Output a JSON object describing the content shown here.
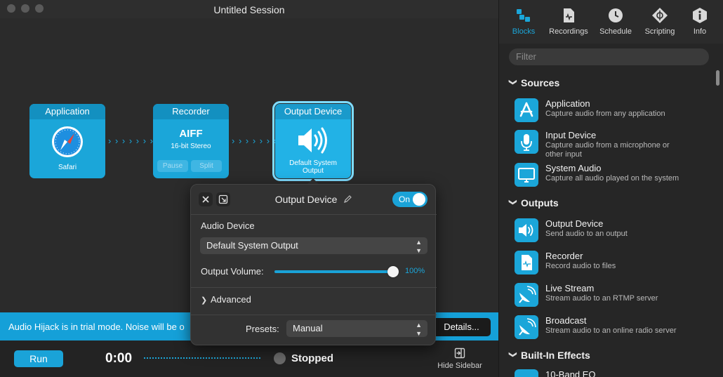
{
  "window": {
    "title": "Untitled Session"
  },
  "blocks": {
    "application": {
      "header": "Application",
      "label": "Safari"
    },
    "recorder": {
      "header": "Recorder",
      "format": "AIFF",
      "detail": "16-bit Stereo",
      "pause_label": "Pause",
      "split_label": "Split"
    },
    "output": {
      "header": "Output Device",
      "label_line1": "Default System",
      "label_line2": "Output"
    }
  },
  "arrows": "› › › › › › ›",
  "popover": {
    "title": "Output Device",
    "toggle_label": "On",
    "audio_device_label": "Audio Device",
    "audio_device_value": "Default System Output",
    "output_volume_label": "Output Volume:",
    "output_volume_percent": 100,
    "output_volume_text": "100%",
    "advanced_label": "Advanced",
    "presets_label": "Presets:",
    "presets_value": "Manual"
  },
  "trial": {
    "text": "Audio Hijack is in trial mode. Noise will be o",
    "details_label": "Details..."
  },
  "transport": {
    "run_label": "Run",
    "time": "0:00",
    "status": "Stopped",
    "hide_sidebar_label": "Hide Sidebar"
  },
  "sidebar": {
    "tabs": [
      {
        "label": "Blocks",
        "icon": "blocks-icon",
        "active": true
      },
      {
        "label": "Recordings",
        "icon": "recordings-icon",
        "active": false
      },
      {
        "label": "Schedule",
        "icon": "clock-icon",
        "active": false
      },
      {
        "label": "Scripting",
        "icon": "scripting-icon",
        "active": false
      },
      {
        "label": "Info",
        "icon": "info-icon",
        "active": false
      }
    ],
    "filter_placeholder": "Filter",
    "sections": [
      {
        "title": "Sources",
        "items": [
          {
            "title": "Application",
            "desc": "Capture audio from any application",
            "icon": "app-store-icon"
          },
          {
            "title": "Input Device",
            "desc": "Capture audio from a microphone or other input",
            "icon": "microphone-icon"
          },
          {
            "title": "System Audio",
            "desc": "Capture all audio played on the system",
            "icon": "monitor-icon"
          }
        ]
      },
      {
        "title": "Outputs",
        "items": [
          {
            "title": "Output Device",
            "desc": "Send audio to an output",
            "icon": "speaker-icon"
          },
          {
            "title": "Recorder",
            "desc": "Record audio to files",
            "icon": "document-icon"
          },
          {
            "title": "Live Stream",
            "desc": "Stream audio to an RTMP server",
            "icon": "broadcast-dish-icon"
          },
          {
            "title": "Broadcast",
            "desc": "Stream audio to an online radio server",
            "icon": "satellite-dish-icon"
          }
        ]
      },
      {
        "title": "Built-In Effects",
        "items": [
          {
            "title": "10-Band EQ",
            "desc": "",
            "icon": "eq-icon"
          }
        ]
      }
    ]
  },
  "colors": {
    "accent": "#1ba6d9",
    "background": "#2b2b2b",
    "sidebar": "#262626"
  }
}
